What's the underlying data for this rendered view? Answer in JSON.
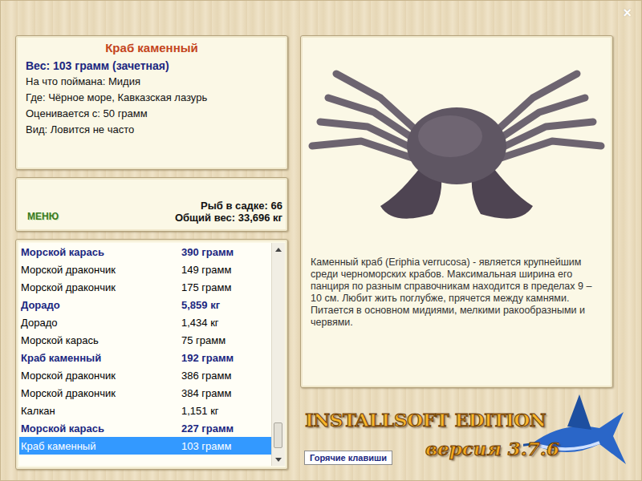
{
  "close": "×",
  "fish": {
    "name": "Краб каменный",
    "weight": "Вес: 103 грамм (зачетная)",
    "details": [
      "На что поймана: Мидия",
      "Где: Чёрное море, Кавказская лазурь",
      "Оценивается с: 50 грамм",
      "Вид: Ловится не часто"
    ]
  },
  "menu": {
    "label": "МЕНЮ",
    "count": "Рыб в садке: 66",
    "total": "Общий вес: 33,696 кг"
  },
  "catch_list": {
    "rows": [
      {
        "name": "Морской карась",
        "weight": "390 грамм",
        "trophy": true,
        "selected": false
      },
      {
        "name": "Морской дракончик",
        "weight": "149 грамм",
        "trophy": false,
        "selected": false
      },
      {
        "name": "Морской дракончик",
        "weight": "175 грамм",
        "trophy": false,
        "selected": false
      },
      {
        "name": "Дорадо",
        "weight": "5,859 кг",
        "trophy": true,
        "selected": false
      },
      {
        "name": "Дорадо",
        "weight": "1,434 кг",
        "trophy": false,
        "selected": false
      },
      {
        "name": "Морской карась",
        "weight": "75 грамм",
        "trophy": false,
        "selected": false
      },
      {
        "name": "Краб каменный",
        "weight": "192 грамм",
        "trophy": true,
        "selected": false
      },
      {
        "name": "Морской дракончик",
        "weight": "386 грамм",
        "trophy": false,
        "selected": false
      },
      {
        "name": "Морской дракончик",
        "weight": "384 грамм",
        "trophy": false,
        "selected": false
      },
      {
        "name": "Калкан",
        "weight": "1,151 кг",
        "trophy": false,
        "selected": false
      },
      {
        "name": "Морской карась",
        "weight": "227 грамм",
        "trophy": true,
        "selected": false
      },
      {
        "name": "Краб каменный",
        "weight": "103 грамм",
        "trophy": false,
        "selected": true
      }
    ],
    "scrollbar": {
      "level": 0.97
    }
  },
  "description": "Каменный краб (Eriphia verrucosa) - является крупнейшим среди черноморских крабов. Максимальная ширина его панциря по разным справочникам находится в пределах 9 – 10 см. Любит жить поглубже, прячется между камнями. Питается в основном мидиями, мелкими ракообразными и червями.",
  "logo": {
    "title": "INSTALLSOFT EDITION",
    "version": "версия 3.7.6"
  },
  "hotkeys_button": "Горячие клавиши"
}
